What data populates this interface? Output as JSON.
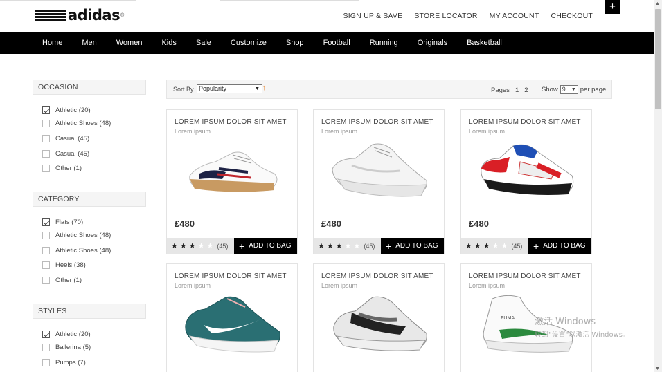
{
  "brand": {
    "name": "adidas"
  },
  "top_links": [
    "SIGN UP & SAVE",
    "STORE LOCATOR",
    "MY ACCOUNT",
    "CHECKOUT"
  ],
  "top_plus": "+",
  "nav": [
    "Home",
    "Men",
    "Women",
    "Kids",
    "Sale",
    "Customize",
    "Shop",
    "Football",
    "Running",
    "Originals",
    "Basketball"
  ],
  "filters": {
    "occasion": {
      "title": "OCCASION",
      "items": [
        {
          "label": "Athletic (20)",
          "checked": true
        },
        {
          "label": "Athletic Shoes (48)",
          "checked": false
        },
        {
          "label": "Casual (45)",
          "checked": false
        },
        {
          "label": "Casual (45)",
          "checked": false
        },
        {
          "label": "Other (1)",
          "checked": false
        }
      ]
    },
    "category": {
      "title": "CATEGORY",
      "items": [
        {
          "label": "Flats (70)",
          "checked": true
        },
        {
          "label": "Athletic Shoes (48)",
          "checked": false
        },
        {
          "label": "Athletic Shoes (48)",
          "checked": false
        },
        {
          "label": "Heels (38)",
          "checked": false
        },
        {
          "label": "Other (1)",
          "checked": false
        }
      ]
    },
    "styles": {
      "title": "STYLES",
      "items": [
        {
          "label": "Athletic (20)",
          "checked": true
        },
        {
          "label": "Ballerina (5)",
          "checked": false
        },
        {
          "label": "Pumps (7)",
          "checked": false
        }
      ]
    }
  },
  "sort": {
    "label": "Sort By",
    "value": "Popularity",
    "direction_icon": "↑"
  },
  "pagination": {
    "label": "Pages",
    "pages": [
      "1",
      "2"
    ]
  },
  "show": {
    "label": "Show",
    "value": "9",
    "suffix": "per page"
  },
  "products": [
    {
      "title": "LOREM IPSUM DOLOR SIT AMET",
      "subtitle": "Lorem ipsum",
      "price": "£480",
      "rating": 3,
      "reviews": "(45)",
      "button": "ADD TO BAG",
      "image": "white-navy-red-sneaker"
    },
    {
      "title": "LOREM IPSUM DOLOR SIT AMET",
      "subtitle": "Lorem ipsum",
      "price": "£480",
      "rating": 3,
      "reviews": "(45)",
      "button": "ADD TO BAG",
      "image": "white-running-shoe"
    },
    {
      "title": "LOREM IPSUM DOLOR SIT AMET",
      "subtitle": "Lorem ipsum",
      "price": "£480",
      "rating": 3,
      "reviews": "(45)",
      "button": "ADD TO BAG",
      "image": "red-black-skate-shoe"
    },
    {
      "title": "LOREM IPSUM DOLOR SIT AMET",
      "subtitle": "Lorem ipsum",
      "image": "teal-nike-shoe"
    },
    {
      "title": "LOREM IPSUM DOLOR SIT AMET",
      "subtitle": "Lorem ipsum",
      "image": "grey-black-running-shoe"
    },
    {
      "title": "LOREM IPSUM DOLOR SIT AMET",
      "subtitle": "Lorem ipsum",
      "image": "white-green-puma-high-top"
    }
  ],
  "watermark": {
    "line1": "激活 Windows",
    "line2": "转到\"设置\"以激活 Windows。"
  },
  "colors": {
    "nav_bg": "#000000",
    "accent_arrow": "#e67e22"
  }
}
